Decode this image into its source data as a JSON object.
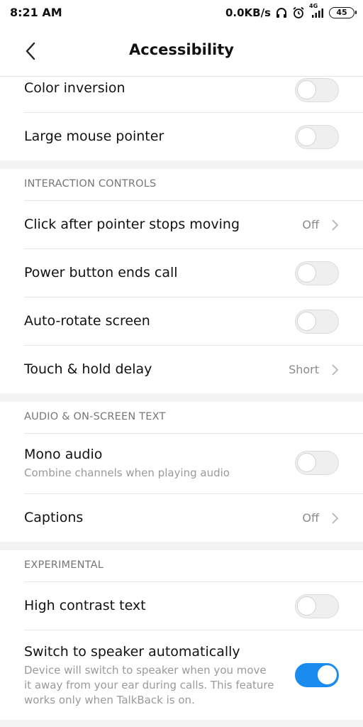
{
  "status_bar": {
    "time": "8:21 AM",
    "net_speed": "0.0KB/s",
    "network_type": "4G",
    "battery": "45",
    "icons": [
      "headphones-icon",
      "alarm-icon",
      "signal-icon",
      "battery-icon"
    ]
  },
  "header": {
    "title": "Accessibility",
    "back_icon": "back-arrow-icon"
  },
  "rows_top": [
    {
      "title": "Color inversion",
      "control": "toggle",
      "on": false
    },
    {
      "title": "Large mouse pointer",
      "control": "toggle",
      "on": false
    }
  ],
  "sections": [
    {
      "header": "INTERACTION CONTROLS",
      "items": [
        {
          "title": "Click after pointer stops moving",
          "control": "value",
          "value": "Off"
        },
        {
          "title": "Power button ends call",
          "control": "toggle",
          "on": false
        },
        {
          "title": "Auto-rotate screen",
          "control": "toggle",
          "on": false
        },
        {
          "title": "Touch & hold delay",
          "control": "value",
          "value": "Short"
        }
      ]
    },
    {
      "header": "AUDIO & ON-SCREEN TEXT",
      "items": [
        {
          "title": "Mono audio",
          "subtitle": "Combine channels when playing audio",
          "control": "toggle",
          "on": false
        },
        {
          "title": "Captions",
          "control": "value",
          "value": "Off"
        }
      ]
    },
    {
      "header": "EXPERIMENTAL",
      "items": [
        {
          "title": "High contrast text",
          "control": "toggle",
          "on": false
        },
        {
          "title": "Switch to speaker automatically",
          "subtitle_lines": [
            "Device will switch to speaker when you move",
            "it away from your ear during calls. This feature",
            "works only when TalkBack is on."
          ],
          "control": "toggle",
          "on": true
        }
      ]
    }
  ],
  "colors": {
    "accent": "#1a8cf0",
    "toggle_off": "#efefef",
    "section_gap": "#f3f3f3",
    "secondary_text": "#8a8a8a"
  }
}
